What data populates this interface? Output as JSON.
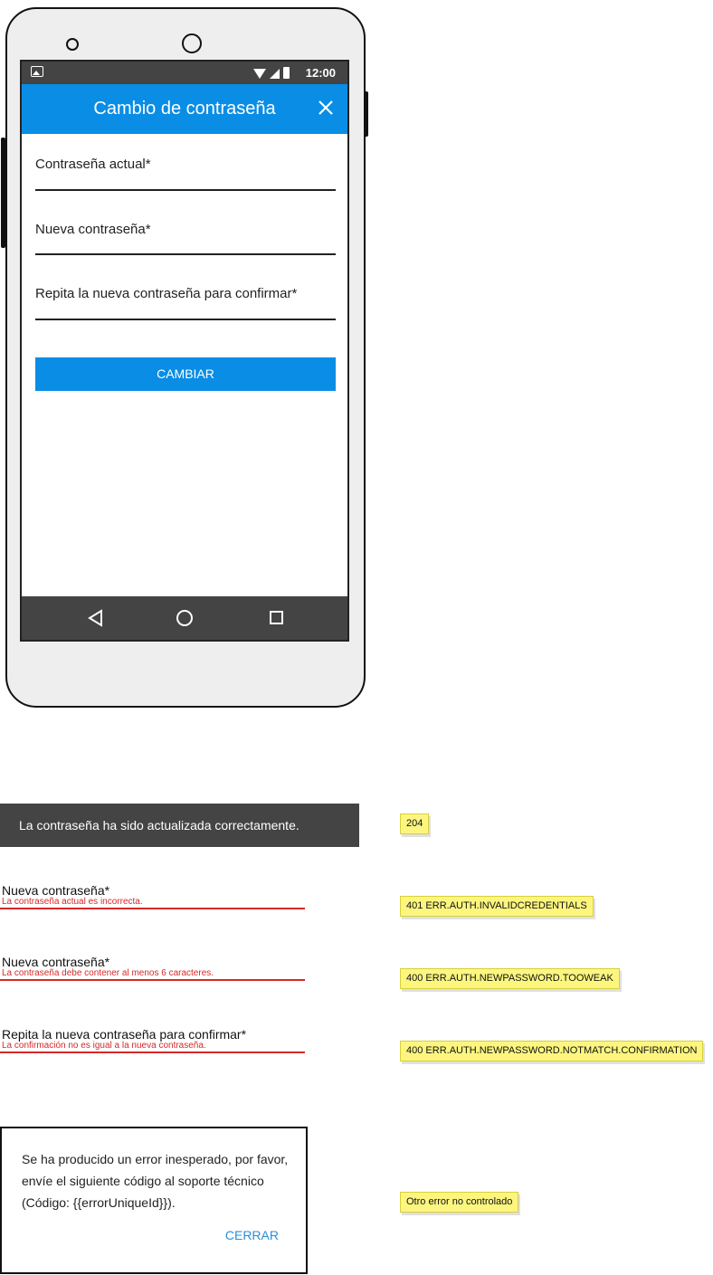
{
  "statusbar": {
    "time": "12:00"
  },
  "appbar": {
    "title": "Cambio de contraseña"
  },
  "form": {
    "current_label": "Contraseña actual*",
    "new_label": "Nueva contraseña*",
    "confirm_label": "Repita la nueva contraseña para confirmar*",
    "submit_label": "CAMBIAR"
  },
  "toast": {
    "text": "La contraseña ha sido actualizada correctamente.",
    "code": "204"
  },
  "errors": [
    {
      "label": "Nueva contraseña*",
      "message": "La contraseña actual es incorrecta.",
      "code": "401 ERR.AUTH.INVALIDCREDENTIALS"
    },
    {
      "label": "Nueva contraseña*",
      "message": "La contraseña debe contener al menos 6 caracteres.",
      "code": "400 ERR.AUTH.NEWPASSWORD.TOOWEAK"
    },
    {
      "label": "Repita la nueva contraseña para confirmar*",
      "message": "La confirmación no es igual a la nueva contraseña.",
      "code": "400 ERR.AUTH.NEWPASSWORD.NOTMATCH.CONFIRMATION"
    }
  ],
  "dialog": {
    "text": "Se ha producido un error inesperado, por favor, envíe el siguiente código al soporte técnico (Código: {{errorUniqueId}}).",
    "button": "CERRAR",
    "code": "Otro error no controlado"
  },
  "colors": {
    "primary": "#0a8de5",
    "error": "#d62828",
    "note": "#fcf67f",
    "bar": "#444444"
  },
  "icons": {
    "close": "close-icon",
    "back": "nav-back-icon",
    "home": "nav-home-icon",
    "recent": "nav-recent-icon"
  }
}
